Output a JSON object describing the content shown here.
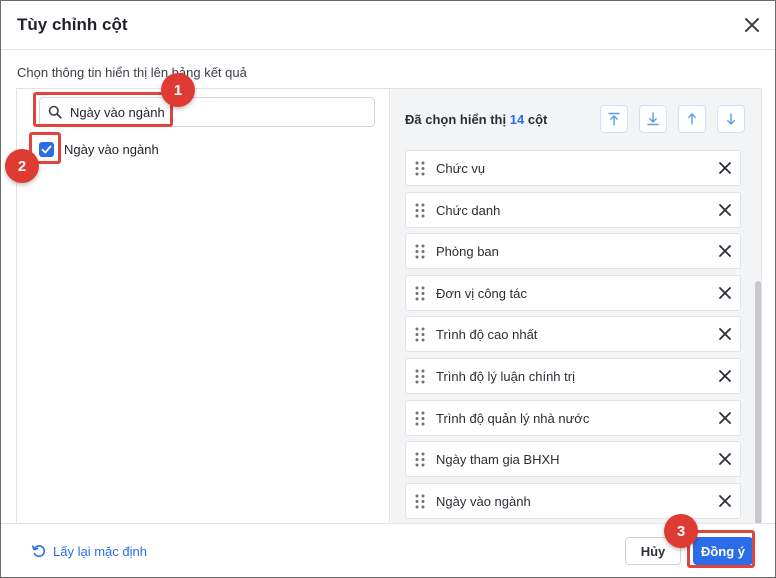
{
  "dialog": {
    "title": "Tùy chỉnh cột",
    "subtitle": "Chọn thông tin hiển thị lên bảng kết quả"
  },
  "search": {
    "value": "Ngày vào ngành"
  },
  "results": [
    {
      "label": "Ngày vào ngành",
      "checked": true
    }
  ],
  "selected": {
    "prefix": "Đã chọn hiển thị",
    "count": "14",
    "suffix": "cột",
    "tools": [
      "move-top-icon",
      "move-bottom-icon",
      "move-up-icon",
      "move-down-icon"
    ],
    "items": [
      "Chức vụ",
      "Chức danh",
      "Phòng ban",
      "Đơn vị công tác",
      "Trình độ cao nhất",
      "Trình độ lý luận chính trị",
      "Trình độ quản lý nhà nước",
      "Ngày tham gia BHXH",
      "Ngày vào ngành"
    ]
  },
  "footer": {
    "reset_label": "Lấy lại mặc định",
    "cancel_label": "Hủy",
    "ok_label": "Đồng ý"
  },
  "annotations": {
    "steps": [
      "1",
      "2",
      "3"
    ],
    "color": "#de3b33"
  },
  "colors": {
    "accent": "#2b6de8"
  }
}
